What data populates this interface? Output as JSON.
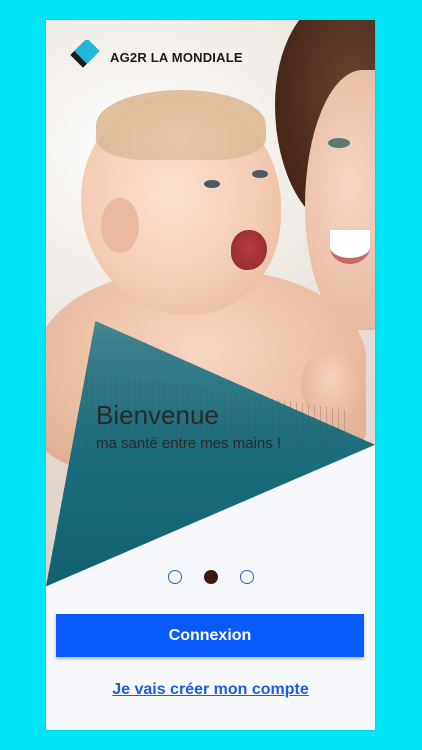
{
  "brand": {
    "name": "AG2R LA MONDIALE",
    "colors": {
      "mark_primary": "#1FB8D8",
      "mark_dark": "#1d1d1d",
      "accent": "#0A5BFF",
      "frame": "#00E5F5"
    }
  },
  "hero": {
    "image": "mother-and-baby-photo",
    "title": "Bienvenue",
    "subtitle": "ma santé entre mes mains !"
  },
  "pager": {
    "count": 3,
    "active_index": 1
  },
  "actions": {
    "login_label": "Connexion",
    "create_account_label": "Je vais créer mon compte"
  }
}
